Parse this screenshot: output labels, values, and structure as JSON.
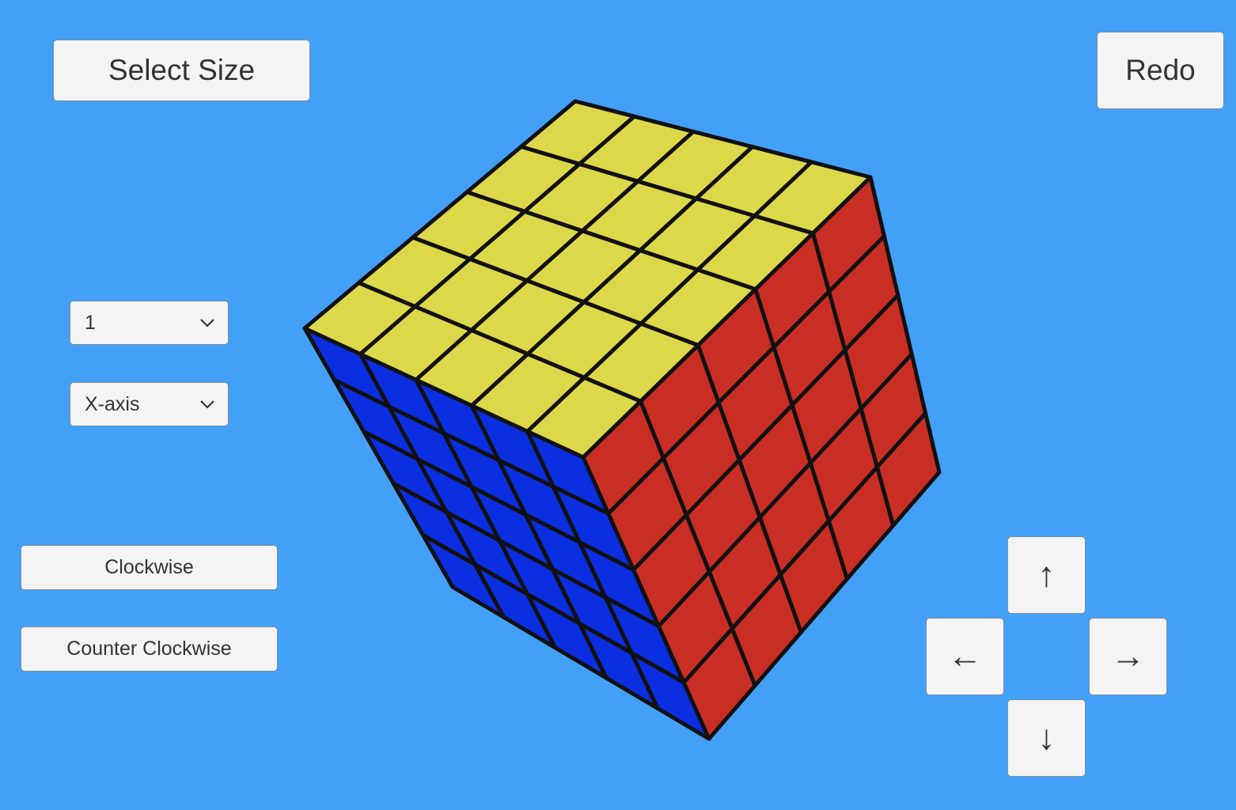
{
  "toolbar": {
    "select_size_label": "Select Size",
    "redo_label": "Redo"
  },
  "controls": {
    "layer_select": {
      "value": "1"
    },
    "axis_select": {
      "value": "X-axis"
    },
    "clockwise_label": "Clockwise",
    "counter_clockwise_label": "Counter Clockwise"
  },
  "arrows": {
    "up": "↑",
    "down": "↓",
    "left": "←",
    "right": "→"
  },
  "cube": {
    "size": 5,
    "faces": {
      "top": "#dcd84a",
      "left": "#0b2ee0",
      "right": "#c92e25"
    },
    "edge_color": "#111111",
    "background": "#42a0f7"
  },
  "icons": {
    "dropdown": "chevron-down-icon"
  }
}
